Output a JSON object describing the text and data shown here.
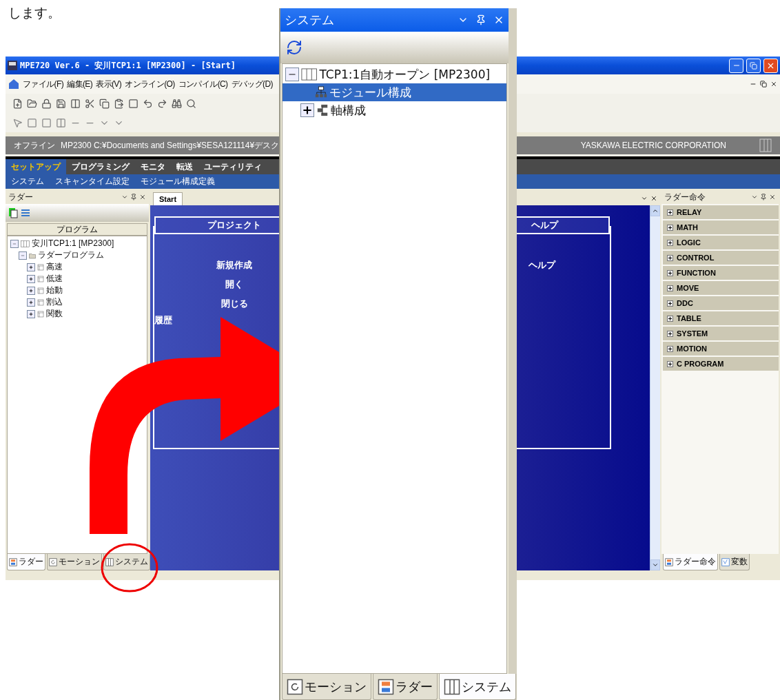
{
  "page_text": "します。",
  "main_window": {
    "title": "MPE720 Ver.6 - 安川TCP1:1 [MP2300] - [Start]",
    "menu": [
      "ファイル(F)",
      "編集(E)",
      "表示(V)",
      "オンライン(O)",
      "コンパイル(C)",
      "デバッグ(D)"
    ],
    "status_bar": {
      "mode": "オフライン",
      "path": "MP2300 C:¥Documents and Settings¥SESA121114¥デスク",
      "company": "YASKAWA ELECTRIC CORPORATION"
    },
    "ribbon_tabs": [
      {
        "label": "セットアップ",
        "selected": true
      },
      {
        "label": "プログラミング",
        "selected": false
      },
      {
        "label": "モニタ",
        "selected": false
      },
      {
        "label": "転送",
        "selected": false
      },
      {
        "label": "ユーティリティ",
        "selected": false
      }
    ],
    "sub_menu": [
      "システム",
      "スキャンタイム設定",
      "モジュール構成定義"
    ],
    "left_pane": {
      "title": "ラダー",
      "column_header": "プログラム",
      "tree": [
        {
          "label": "安川TCP1:1 [MP2300]",
          "kind": "controller",
          "expanded": true,
          "children": [
            {
              "label": "ラダープログラム",
              "kind": "folder",
              "expanded": true,
              "children": [
                {
                  "label": "高速",
                  "kind": "program",
                  "expanded": false
                },
                {
                  "label": "低速",
                  "kind": "program",
                  "expanded": false
                },
                {
                  "label": "始動",
                  "kind": "program",
                  "expanded": false
                },
                {
                  "label": "割込",
                  "kind": "program",
                  "expanded": false
                },
                {
                  "label": "関数",
                  "kind": "program",
                  "expanded": false
                }
              ]
            }
          ]
        }
      ],
      "tabs": [
        {
          "label": "ラダー",
          "kind": "ladder",
          "selected": true
        },
        {
          "label": "モーション",
          "kind": "motion",
          "selected": false
        },
        {
          "label": "システム",
          "kind": "system",
          "selected": false
        }
      ]
    },
    "document": {
      "tab": "Start",
      "project": {
        "title": "プロジェクト",
        "links": [
          "新規作成",
          "開く",
          "閉じる"
        ],
        "history": "履歴"
      },
      "help": {
        "title": "ヘルプ",
        "links": [
          "ヘルプ"
        ]
      }
    },
    "right_pane": {
      "title": "ラダー命令",
      "groups": [
        "RELAY",
        "MATH",
        "LOGIC",
        "CONTROL",
        "FUNCTION",
        "MOVE",
        "DDC",
        "TABLE",
        "SYSTEM",
        "MOTION",
        "C PROGRAM"
      ],
      "tabs": [
        {
          "label": "ラダー命令",
          "kind": "ladder",
          "selected": true
        },
        {
          "label": "変数",
          "kind": "variable",
          "selected": false
        }
      ]
    }
  },
  "system_panel": {
    "title": "システム",
    "tree": [
      {
        "label": "TCP1:1自動オープン [MP2300]",
        "kind": "controller",
        "expanded": true,
        "selected": false,
        "children": [
          {
            "label": "モジュール構成",
            "kind": "modules",
            "selected": true
          },
          {
            "label": "軸構成",
            "kind": "axes",
            "expanded": false,
            "selected": false
          }
        ]
      }
    ],
    "tabs": [
      {
        "label": "モーション",
        "kind": "motion",
        "selected": false
      },
      {
        "label": "ラダー",
        "kind": "ladder",
        "selected": false
      },
      {
        "label": "システム",
        "kind": "system",
        "selected": true
      }
    ]
  }
}
